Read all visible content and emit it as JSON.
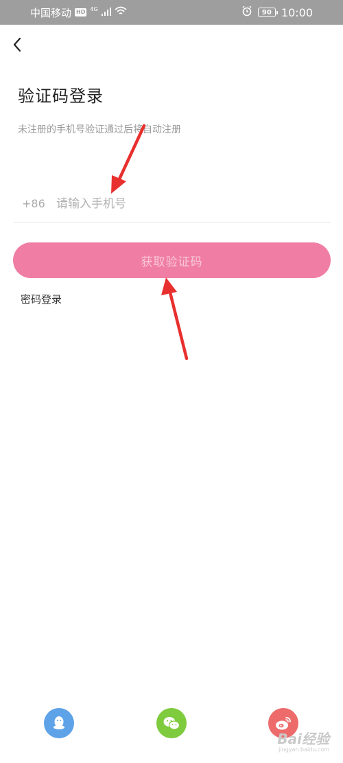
{
  "status_bar": {
    "carrier": "中国移动",
    "hd_badge": "HD",
    "network": "4G",
    "battery": "90",
    "time": "10:00"
  },
  "header": {
    "back_icon": "chevron-left-icon"
  },
  "login": {
    "title": "验证码登录",
    "subtitle": "未注册的手机号验证通过后将自动注册",
    "country_code": "+86",
    "phone_placeholder": "请输入手机号",
    "phone_value": "",
    "get_code_label": "获取验证码",
    "password_login_label": "密码登录"
  },
  "social": {
    "items": [
      {
        "name": "qq",
        "icon": "qq-icon",
        "color": "#5ea2e8"
      },
      {
        "name": "wechat",
        "icon": "wechat-icon",
        "color": "#7ecb3e"
      },
      {
        "name": "weibo",
        "icon": "weibo-icon",
        "color": "#ee6b6b"
      }
    ]
  },
  "watermark": {
    "brand": "Bai经验",
    "url": "jingyan.baidu.com"
  },
  "colors": {
    "accent": "#f07da4",
    "annotation_arrow": "#e8302f",
    "status_bar": "#9e9e9e"
  }
}
